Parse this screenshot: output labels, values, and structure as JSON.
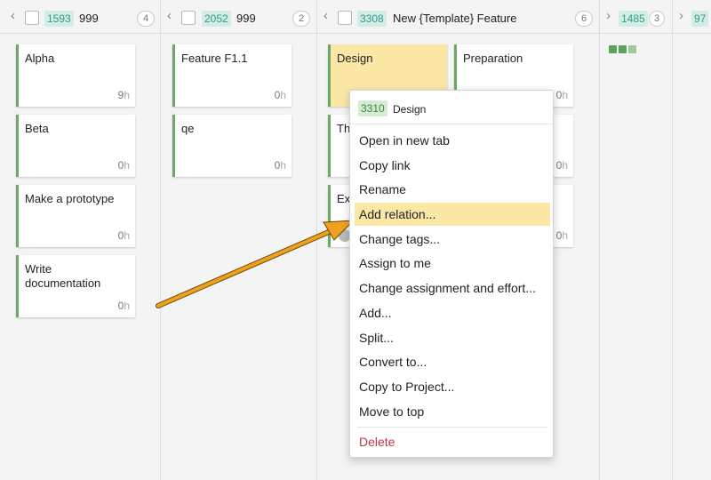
{
  "columns": [
    {
      "id": "1593",
      "title": "999",
      "count": "4"
    },
    {
      "id": "2052",
      "title": "999",
      "count": "2"
    },
    {
      "id": "3308",
      "title": "New {Template} Feature",
      "count": "6"
    },
    {
      "id": "1485",
      "count": "3"
    },
    {
      "id": "97"
    }
  ],
  "cards": {
    "col1": [
      {
        "title": "Alpha",
        "effort": "9",
        "unit": "h"
      },
      {
        "title": "Beta",
        "effort": "0",
        "unit": "h"
      },
      {
        "title": "Make a prototype",
        "effort": "0",
        "unit": "h"
      },
      {
        "title": "Write documentation",
        "effort": "0",
        "unit": "h"
      }
    ],
    "col2": [
      {
        "title": "Feature F1.1",
        "effort": "0",
        "unit": "h"
      },
      {
        "title": "qe",
        "effort": "0",
        "unit": "h"
      }
    ],
    "col3": [
      {
        "title": "Design"
      },
      {
        "title": "Th"
      },
      {
        "title": "Ex"
      },
      {
        "title": "Preparation",
        "effort": "0",
        "unit": "h"
      },
      {
        "effort": "0",
        "unit": "h"
      },
      {
        "effort": "0",
        "unit": "h"
      }
    ]
  },
  "context_menu": {
    "header_id": "3310",
    "header_title": "Design",
    "items": [
      "Open in new tab",
      "Copy link",
      "Rename",
      "Add relation...",
      "Change tags...",
      "Assign to me",
      "Change assignment and effort...",
      "Add...",
      "Split...",
      "Convert to...",
      "Copy to Project...",
      "Move to top"
    ],
    "danger_item": "Delete",
    "active_index": 3
  },
  "colors": {
    "accent_green": "#6aaa62",
    "highlight": "#fbe7a6",
    "arrow": "#f0a020",
    "danger": "#c0334d"
  }
}
